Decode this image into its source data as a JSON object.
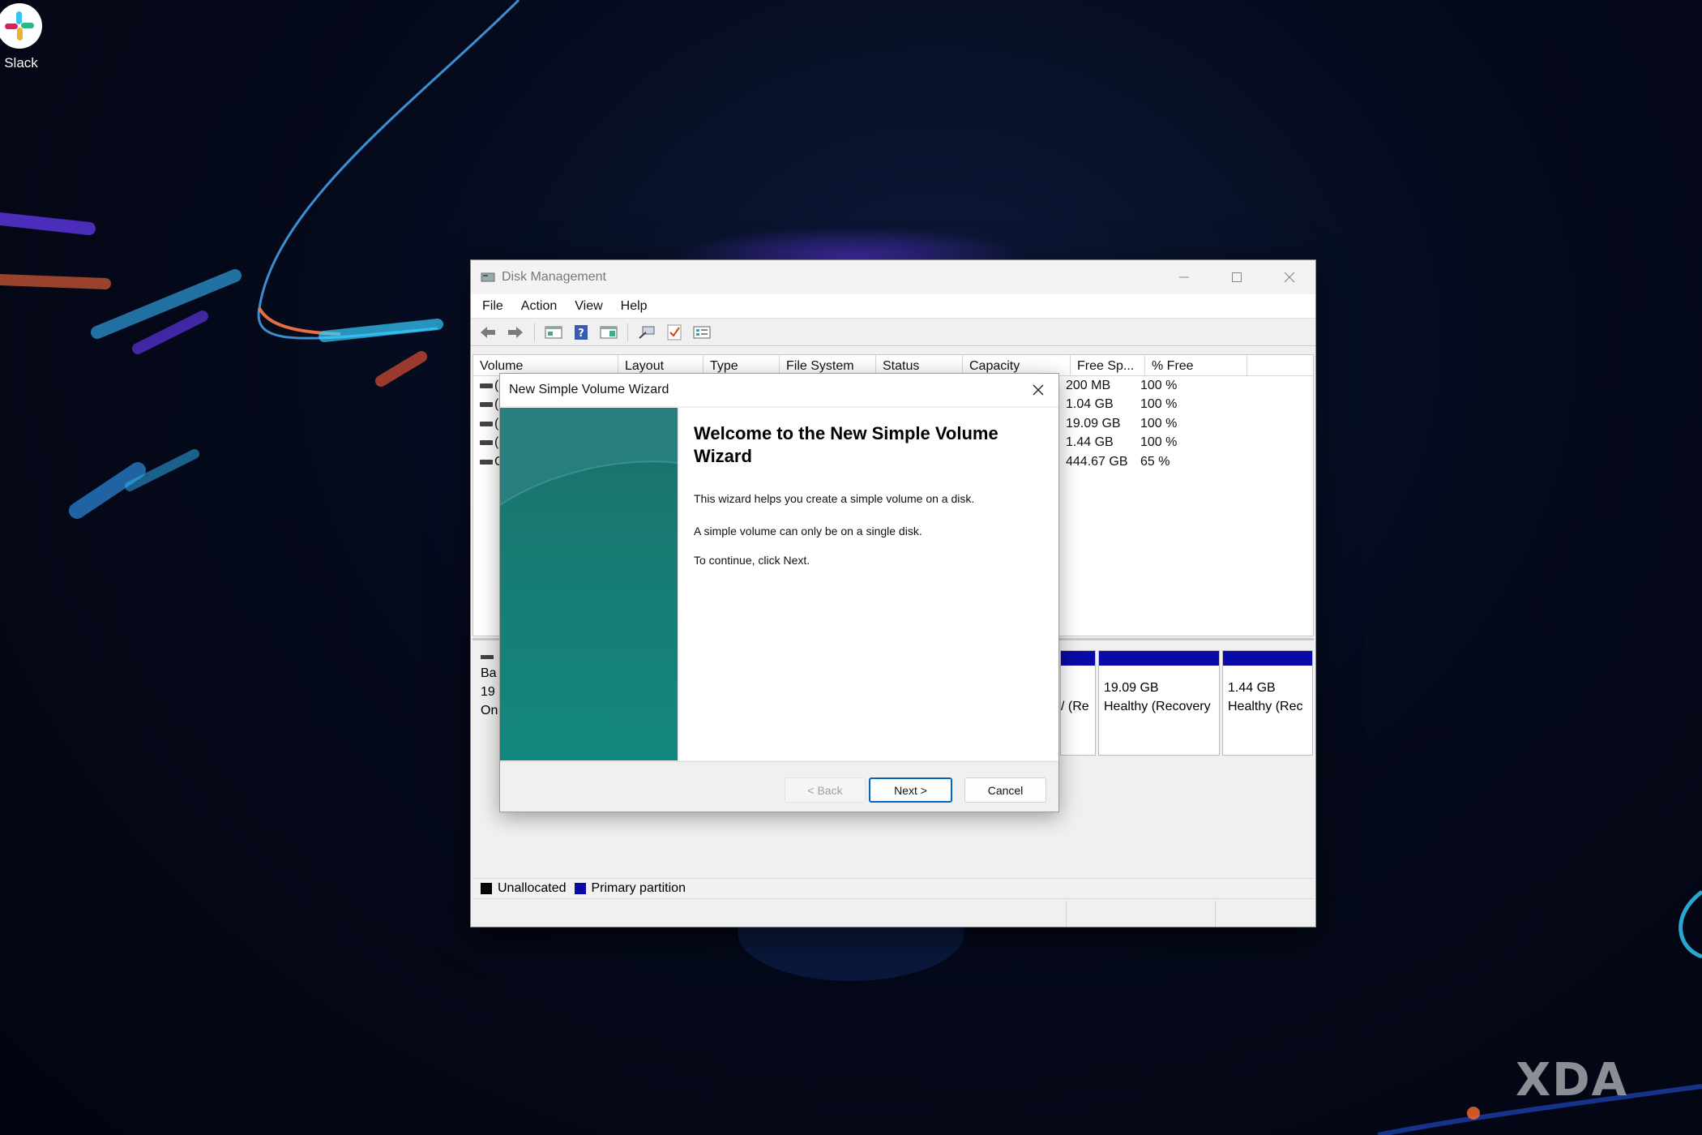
{
  "desktop": {
    "icons": [
      {
        "label": "Slack"
      }
    ],
    "watermark": "XDA"
  },
  "window": {
    "title": "Disk Management",
    "menu": [
      "File",
      "Action",
      "View",
      "Help"
    ],
    "toolbar_icons": [
      "back-arrow-icon",
      "forward-arrow-icon",
      "disk-list-icon",
      "help-icon",
      "console-icon",
      "connect-icon",
      "check-icon",
      "properties-icon"
    ],
    "columns": [
      "Volume",
      "Layout",
      "Type",
      "File System",
      "Status",
      "Capacity",
      "Free Sp...",
      "% Free"
    ],
    "volumes": [
      {
        "volume": "(",
        "free_space": "200 MB",
        "percent_free": "100 %"
      },
      {
        "volume": "(",
        "free_space": "1.04 GB",
        "percent_free": "100 %"
      },
      {
        "volume": "(",
        "free_space": "19.09 GB",
        "percent_free": "100 %"
      },
      {
        "volume": "(",
        "free_space": "1.44 GB",
        "percent_free": "100 %"
      },
      {
        "volume": "C",
        "free_space": "444.67 GB",
        "percent_free": "65 %"
      }
    ],
    "disk": {
      "info_lines": [
        "Ba",
        "19",
        "On"
      ],
      "partitions": [
        {
          "size": "",
          "status": "/ (Re"
        },
        {
          "size": "19.09 GB",
          "status": "Healthy (Recovery"
        },
        {
          "size": "1.44 GB",
          "status": "Healthy (Rec"
        }
      ]
    },
    "legend": [
      {
        "label": "Unallocated",
        "color": "#000000"
      },
      {
        "label": "Primary partition",
        "color": "#0a0aa8"
      }
    ]
  },
  "wizard": {
    "title": "New Simple Volume Wizard",
    "heading": "Welcome to the New Simple Volume Wizard",
    "paragraphs": [
      "This wizard helps you create a simple volume on a disk.",
      "A simple volume can only be on a single disk.",
      "To continue, click Next."
    ],
    "buttons": {
      "back": "< Back",
      "next": "Next >",
      "cancel": "Cancel"
    }
  },
  "colors": {
    "primary_partition": "#0a0aa8",
    "accent": "#0067c0",
    "wizard_side": "#177b74"
  }
}
